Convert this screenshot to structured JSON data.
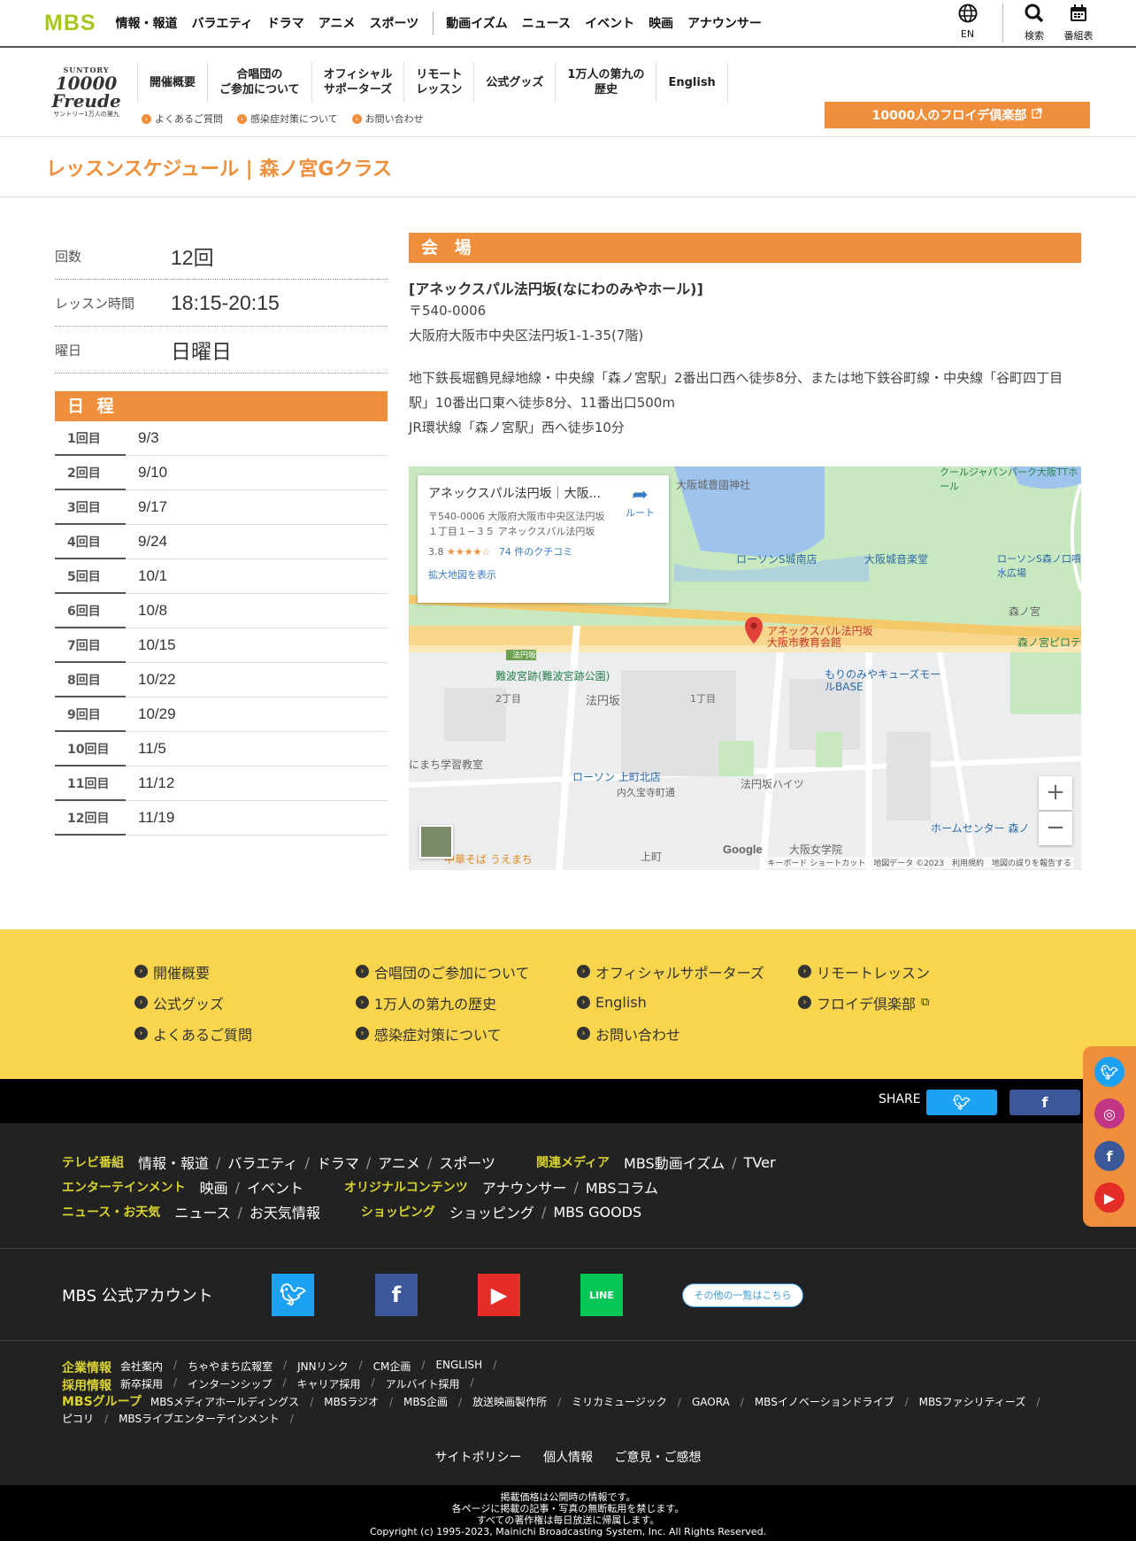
{
  "topbar": {
    "logo": "MBS",
    "nav": [
      "情報・報道",
      "バラエティ",
      "ドラマ",
      "アニメ",
      "スポーツ"
    ],
    "nav2": [
      "動画イズム",
      "ニュース",
      "イベント",
      "映画",
      "アナウンサー"
    ],
    "en_label": "EN",
    "search_label": "検索",
    "schedule_label": "番組表"
  },
  "brand": {
    "line1": "SUNTORY",
    "line2": "10000 Freude",
    "line3": "サントリー1万人の第九"
  },
  "subnav": [
    "開催概要",
    "合唱団の\nご参加について",
    "オフィシャル\nサポーターズ",
    "リモート\nレッスン",
    "公式グッズ",
    "1万人の第九の\n歴史",
    "English"
  ],
  "sublinks": [
    "よくあるご質問",
    "感染症対策について",
    "お問い合わせ"
  ],
  "club_button": "10000人のフロイデ倶楽部",
  "page_title": "レッスンスケジュール | 森ノ宮Gクラス",
  "info": [
    {
      "k": "回数",
      "v": "12回"
    },
    {
      "k": "レッスン時間",
      "v": "18:15-20:15"
    },
    {
      "k": "曜日",
      "v": "日曜日"
    }
  ],
  "schedule_title": "日 程",
  "schedule": [
    {
      "n": "1回目",
      "d": "9/3"
    },
    {
      "n": "2回目",
      "d": "9/10"
    },
    {
      "n": "3回目",
      "d": "9/17"
    },
    {
      "n": "4回目",
      "d": "9/24"
    },
    {
      "n": "5回目",
      "d": "10/1"
    },
    {
      "n": "6回目",
      "d": "10/8"
    },
    {
      "n": "7回目",
      "d": "10/15"
    },
    {
      "n": "8回目",
      "d": "10/22"
    },
    {
      "n": "9回目",
      "d": "10/29"
    },
    {
      "n": "10回目",
      "d": "11/5"
    },
    {
      "n": "11回目",
      "d": "11/12"
    },
    {
      "n": "12回目",
      "d": "11/19"
    }
  ],
  "venue": {
    "title": "会 場",
    "name": "[アネックスパル法円坂(なにわのみやホール)]",
    "zip": "〒540-0006",
    "address": "大阪府大阪市中央区法円坂1-1-35(7階)",
    "access1": "地下鉄長堀鶴見緑地線・中央線「森ノ宮駅」2番出口西へ徒歩8分、または地下鉄谷町線・中央線「谷町四丁目駅」10番出口東へ徒歩8分、11番出口500m",
    "access2": "JR環状線「森ノ宮駅」西へ徒歩10分"
  },
  "map": {
    "card_title": "アネックスパル法円坂｜大阪...",
    "card_address": "〒540-0006 大阪府大阪市中央区法円坂１丁目１−３５ アネックスパル法円坂",
    "rating": "3.8",
    "stars": "★★★★☆",
    "reviews": "74 件のクチコミ",
    "enlarge": "拡大地図を表示",
    "route": "ルート",
    "labels": {
      "shrine": "大阪城豊國神社",
      "park": "クールジャパンパーク大阪TTホール",
      "lawson1": "ローソンS城南店",
      "music": "大阪城音楽堂",
      "lawson2": "ローソンS森ノ口噴水広場",
      "morinomiya": "森ノ宮",
      "marker": "アネックスパル法円坂\n大阪市教育会館",
      "piloti": "森ノ宮ピロテ",
      "ruins": "難波宮跡(難波宮跡公園)",
      "houenzaka": "法円坂",
      "chome2": "2丁目",
      "chome1": "1丁目",
      "mall": "もりのみやキューズモールBASE",
      "school": "にまち学習教室",
      "lawson3": "ローソン 上町北店",
      "heights": "法円坂ハイツ",
      "kyuhoji": "内久宝寺町通",
      "hc": "ホームセンター 森ノ",
      "soba": "中華そば うえまち",
      "uemachi": "上町",
      "jogakuin": "大阪女学院",
      "sign": "法円坂"
    },
    "google": "Google",
    "footer": "キーボード ショートカット　地図データ ©2023　利用規約　地図の誤りを報告する"
  },
  "ynav": [
    "開催概要",
    "合唱団のご参加について",
    "オフィシャルサポーターズ",
    "リモートレッスン",
    "公式グッズ",
    "1万人の第九の歴史",
    "English",
    "フロイデ倶楽部",
    "よくあるご質問",
    "感染症対策について",
    "お問い合わせ"
  ],
  "share": {
    "label": "SHARE"
  },
  "footer": {
    "tv_cat": "テレビ番組",
    "tv_items": [
      "情報・報道",
      "バラエティ",
      "ドラマ",
      "アニメ",
      "スポーツ"
    ],
    "media_cat": "関連メディア",
    "media_items": [
      "MBS動画イズム",
      "TVer"
    ],
    "ent_cat": "エンターテインメント",
    "ent_items": [
      "映画",
      "イベント"
    ],
    "orig_cat": "オリジナルコンテンツ",
    "orig_items": [
      "アナウンサー",
      "MBSコラム"
    ],
    "news_cat": "ニュース・お天気",
    "news_items": [
      "ニュース",
      "お天気情報"
    ],
    "shop_cat": "ショッピング",
    "shop_items": [
      "ショッピング",
      "MBS GOODS"
    ],
    "account_label": "MBS 公式アカウント",
    "others_label": "その他の一覧はこちら",
    "corp_cat": "企業情報",
    "corp_items": [
      "会社案内",
      "ちゃやまち広報室",
      "JNNリンク",
      "CM企画",
      "ENGLISH"
    ],
    "recruit_cat": "採用情報",
    "recruit_items": [
      "新卒採用",
      "インターンシップ",
      "キャリア採用",
      "アルバイト採用"
    ],
    "group_cat": "MBSグループ",
    "group_items": [
      "MBSメディアホールディングス",
      "MBSラジオ",
      "MBS企画",
      "放送映画製作所",
      "ミリカミュージック",
      "GAORA",
      "MBSイノベーションドライブ",
      "MBSファシリティーズ",
      "ピコリ",
      "MBSライブエンターテインメント"
    ],
    "policy": [
      "サイトポリシー",
      "個人情報",
      "ご意見・ご感想"
    ],
    "copy": [
      "掲載価格は公開時の情報です。",
      "各ページに掲載の記事・写真の無断転用を禁じます。",
      "すべての著作権は毎日放送に帰属します。",
      "Copyright (c) 1995-2023, Mainichi Broadcasting System, Inc. All Rights Reserved."
    ]
  },
  "colors": {
    "accent": "#ef8f3b",
    "footer_yellow": "#f8d54c",
    "footer_cat": "#d8d230",
    "logo_green": "#a6c81e"
  }
}
